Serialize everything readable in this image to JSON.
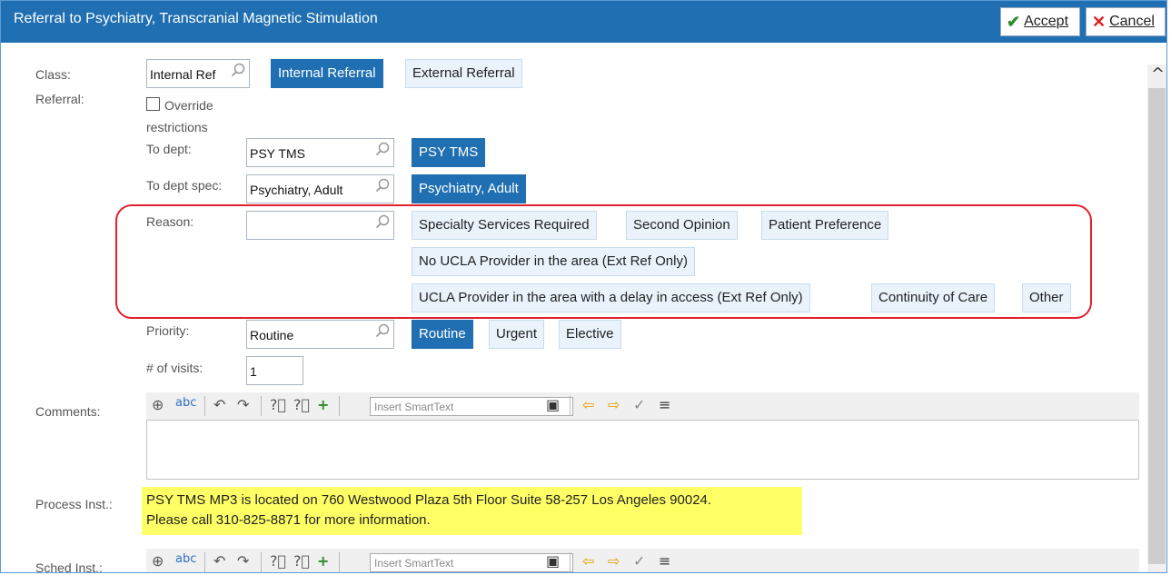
{
  "window": {
    "title": "Referral to Psychiatry, Transcranial Magnetic Stimulation"
  },
  "header": {
    "accept": {
      "label": "Accept",
      "icon": "check-icon",
      "color": "#2e8b2e"
    },
    "cancel": {
      "label": "Cancel",
      "icon": "x-icon",
      "color": "#dd2222"
    }
  },
  "colors": {
    "titlebar": "#1f6fb2",
    "selected_chip": "#1f6fb2",
    "highlight": "#ffff66",
    "annotation": "#e0202a"
  },
  "form": {
    "class": {
      "label": "Class:",
      "value": "Internal Ref",
      "options": [
        {
          "label": "Internal Referral",
          "selected": true
        },
        {
          "label": "External Referral",
          "selected": false
        }
      ]
    },
    "referral": {
      "label": "Referral:",
      "override": {
        "label_line1": "Override",
        "label_line2": "restrictions",
        "checked": false
      },
      "to_dept": {
        "label": "To dept:",
        "value": "PSY TMS",
        "chip": "PSY TMS"
      },
      "to_dept_spec": {
        "label": "To dept spec:",
        "value": "Psychiatry, Adult",
        "chip": "Psychiatry, Adult"
      },
      "reason": {
        "label": "Reason:",
        "value": "",
        "options": [
          "Specialty Services Required",
          "Second Opinion",
          "Patient Preference",
          "No UCLA Provider in the area (Ext Ref Only)",
          "UCLA Provider in the area with a delay in access (Ext Ref Only)",
          "Continuity of Care",
          "Other"
        ]
      },
      "priority": {
        "label": "Priority:",
        "value": "Routine",
        "options": [
          {
            "label": "Routine",
            "selected": true
          },
          {
            "label": "Urgent",
            "selected": false
          },
          {
            "label": "Elective",
            "selected": false
          }
        ]
      },
      "visits": {
        "label": "# of visits:",
        "value": "1"
      }
    },
    "comments": {
      "label": "Comments:",
      "smarttext_placeholder": "Insert SmartText"
    },
    "process_inst": {
      "label": "Process Inst.:",
      "line1": "PSY TMS MP3 is located on 760 Westwood Plaza 5th Floor Suite 58-257 Los Angeles 90024.",
      "line2": "Please call 310-825-8871 for more information."
    },
    "sched_inst": {
      "label": "Sched Inst.:",
      "smarttext_placeholder": "Insert SmartText"
    }
  }
}
